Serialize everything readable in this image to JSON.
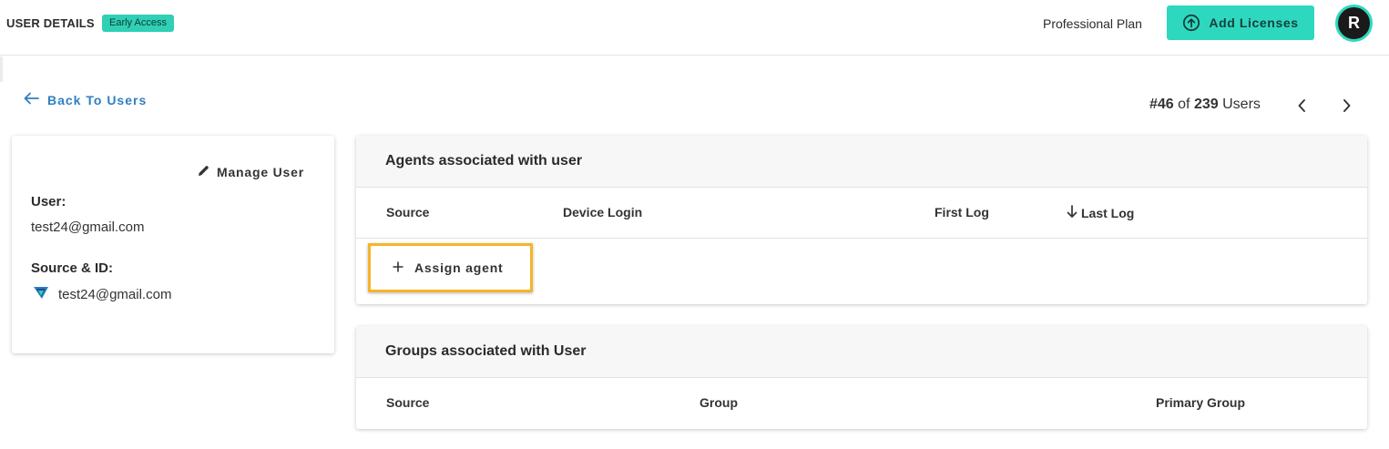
{
  "header": {
    "title": "USER DETAILS",
    "badge": "Early Access",
    "plan": "Professional Plan",
    "add_licenses_label": "Add Licenses",
    "avatar_initial": "R"
  },
  "nav": {
    "back_label": "Back To Users",
    "position": "#46",
    "of_label": "of",
    "total": "239",
    "users_label": "Users"
  },
  "user_card": {
    "manage_label": "Manage User",
    "user_label": "User:",
    "user_value": "test24@gmail.com",
    "source_label": "Source & ID:",
    "source_value": "test24@gmail.com"
  },
  "agents": {
    "title": "Agents associated with user",
    "columns": [
      "Source",
      "Device Login",
      "First Log",
      "Last Log"
    ],
    "assign_label": "Assign agent"
  },
  "groups": {
    "title": "Groups associated with User",
    "columns": [
      "Source",
      "Group",
      "Primary Group"
    ]
  },
  "colors": {
    "accent": "#2ed8bf",
    "link": "#2f7fc1",
    "highlight": "#f5b52a"
  }
}
